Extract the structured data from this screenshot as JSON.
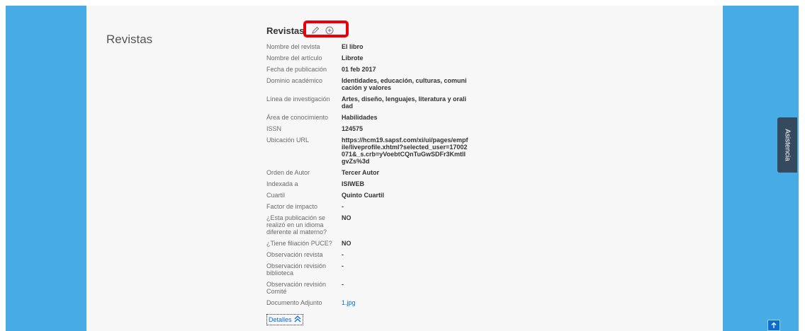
{
  "section": {
    "title": "Revistas"
  },
  "card": {
    "title": "Revistas",
    "icons": {
      "edit": "pencil-icon",
      "add": "plus-circle-icon"
    },
    "highlight_color": "#e8000b"
  },
  "fields": [
    {
      "label": "Nombre del revista",
      "value": "El libro"
    },
    {
      "label": "Nombre del artículo",
      "value": "Librote"
    },
    {
      "label": "Fecha de publicación",
      "value": "01 feb 2017"
    },
    {
      "label": "Dominio académico",
      "value": "Identidades, educación, culturas, comunicación y valores"
    },
    {
      "label": "Línea de investigación",
      "value": "Artes, diseño, lenguajes, literatura y oralidad"
    },
    {
      "label": "Área de conocimiento",
      "value": "Habilidades"
    },
    {
      "label": "ISSN",
      "value": "124575"
    },
    {
      "label": "Ubicación URL",
      "value": "https://hcm19.sapsf.com/xi/ui/pages/empfile/liveprofile.xhtml?selected_user=17002071&_s.crb=yVoebtCQnTuGwSDFr3KmtllgvZs%3d"
    },
    {
      "label": "Orden de Autor",
      "value": "Tercer Autor"
    },
    {
      "label": "Indexada a",
      "value": "ISIWEB"
    },
    {
      "label": "Cuartil",
      "value": "Quinto Cuartil"
    },
    {
      "label": "Factor de impacto",
      "value": "-"
    },
    {
      "label": "¿Esta publicación se realizó en un idioma diferente al materno?",
      "value": "NO"
    },
    {
      "label": "¿Tiene filiación PUCE?",
      "value": "NO"
    },
    {
      "label": "Observación revista",
      "value": "-"
    },
    {
      "label": "Observación revisión biblioteca",
      "value": "-"
    },
    {
      "label": "Observación revisión Comité",
      "value": "-"
    },
    {
      "label": "Documento Adjunto",
      "value": "1.jpg"
    }
  ],
  "details_link": {
    "label": "Detalles",
    "icon": "double-chevron-up-icon"
  },
  "assist_tab": {
    "label": "Asistencia"
  },
  "scroll_top": {
    "icon": "arrow-up-icon"
  },
  "colors": {
    "side_panel": "#47ace6",
    "link": "#0a6ed1",
    "content_bg": "#f7f7f7"
  }
}
